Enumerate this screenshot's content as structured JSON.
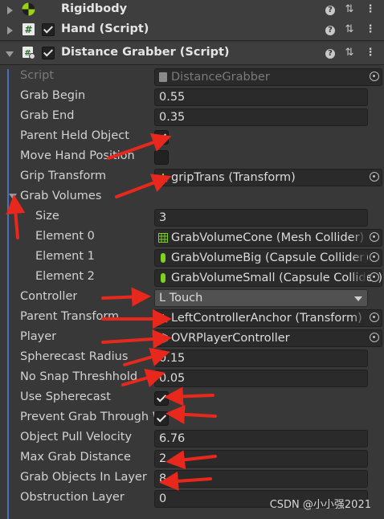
{
  "components": [
    {
      "title": "Rigidbody",
      "expanded": false,
      "has_checkbox": false,
      "icon": "rigidbody-icon"
    },
    {
      "title": "Hand (Script)",
      "expanded": false,
      "has_checkbox": true,
      "icon": "script-icon"
    },
    {
      "title": "Distance Grabber (Script)",
      "expanded": true,
      "has_checkbox": true,
      "icon": "script-gear-icon"
    }
  ],
  "header_icons": {
    "help": "?",
    "presets": "⇅",
    "more": "⋮"
  },
  "fields": {
    "script": {
      "label": "Script",
      "value": "DistanceGrabber"
    },
    "grab_begin": {
      "label": "Grab Begin",
      "value": "0.55"
    },
    "grab_end": {
      "label": "Grab End",
      "value": "0.35"
    },
    "parent_held_object": {
      "label": "Parent Held Object",
      "checked": true
    },
    "move_hand_position": {
      "label": "Move Hand Position",
      "checked": false
    },
    "grip_transform": {
      "label": "Grip Transform",
      "value": "gripTrans (Transform)"
    },
    "grab_volumes": {
      "label": "Grab Volumes"
    },
    "size": {
      "label": "Size",
      "value": "3"
    },
    "element0": {
      "label": "Element 0",
      "value": "GrabVolumeCone (Mesh Collider)"
    },
    "element1": {
      "label": "Element 1",
      "value": "GrabVolumeBig (Capsule Collider)"
    },
    "element2": {
      "label": "Element 2",
      "value": "GrabVolumeSmall (Capsule Collider)"
    },
    "controller": {
      "label": "Controller",
      "value": "L Touch"
    },
    "parent_transform": {
      "label": "Parent Transform",
      "value": "LeftControllerAnchor (Transform)"
    },
    "player": {
      "label": "Player",
      "value": "OVRPlayerController"
    },
    "spherecast_radius": {
      "label": "Spherecast Radius",
      "value": "0.15"
    },
    "no_snap_threshhold": {
      "label": "No Snap Threshhold",
      "value": "0.05"
    },
    "use_spherecast": {
      "label": "Use Spherecast",
      "checked": true
    },
    "prevent_grab_through_walls": {
      "label": "Prevent Grab Through Walls",
      "checked": true
    },
    "object_pull_velocity": {
      "label": "Object Pull Velocity",
      "value": "6.76"
    },
    "max_grab_distance": {
      "label": "Max Grab Distance",
      "value": "2"
    },
    "grab_objects_in_layer": {
      "label": "Grab Objects In Layer",
      "value": "8"
    },
    "obstruction_layer": {
      "label": "Obstruction Layer",
      "value": "0"
    }
  },
  "watermark": "CSDN @小小强2021",
  "colors": {
    "annotation_arrow": "#e8281c",
    "selection_bar": "#4670b8",
    "background": "#383838",
    "field_bg": "#2a2a2a"
  }
}
